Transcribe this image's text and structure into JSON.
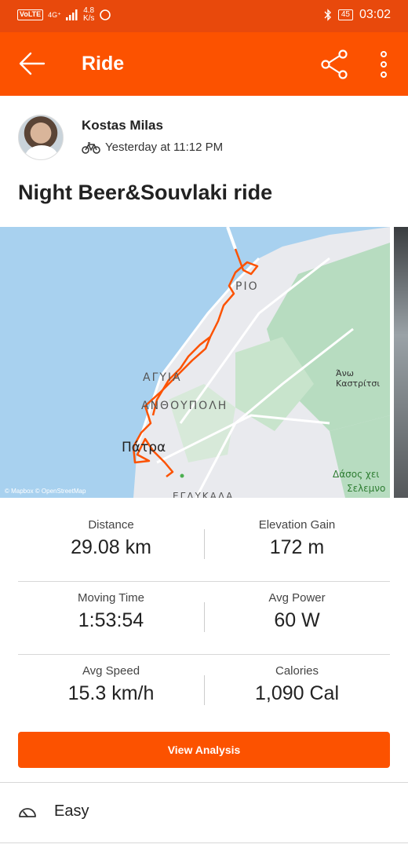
{
  "status_bar": {
    "volte": "VoLTE",
    "network": "4G⁺",
    "speed_value": "4.8",
    "speed_unit": "K/s",
    "battery": "45",
    "time": "03:02"
  },
  "app_bar": {
    "title": "Ride",
    "back_icon": "arrow-left-icon",
    "share_icon": "share-icon",
    "more_icon": "more-vert-icon"
  },
  "athlete": {
    "name": "Kostas Milas",
    "activity_icon": "bicycle-icon",
    "timestamp": "Yesterday at 11:12 PM"
  },
  "activity": {
    "title": "Night Beer&Souvlaki ride"
  },
  "map": {
    "labels": {
      "rio": "ΡΙΟ",
      "agyia": "ΑΓΥΙΑ",
      "anthoupoli": "ΑΝΘΟΥΠΟΛΗ",
      "patra": "Πάτρα",
      "ano_kastritsi": "Άνω Καστρίτσι",
      "dasos": "Δάσος χει",
      "selemno": "Σελεμνο",
      "eglykada": "ΕΓΛΥΚΑΔΑ"
    },
    "credit": "© Mapbox © OpenStreetMap",
    "route_color": "#fc5200",
    "water_color": "#a8d1ef"
  },
  "stats": [
    {
      "label": "Distance",
      "value": "29.08 km"
    },
    {
      "label": "Elevation Gain",
      "value": "172 m"
    },
    {
      "label": "Moving Time",
      "value": "1:53:54"
    },
    {
      "label": "Avg Power",
      "value": "60 W"
    },
    {
      "label": "Avg Speed",
      "value": "15.3 km/h"
    },
    {
      "label": "Calories",
      "value": "1,090 Cal"
    }
  ],
  "view_analysis_label": "View Analysis",
  "effort": {
    "icon": "gauge-icon",
    "label": "Easy"
  },
  "colors": {
    "accent": "#fc5200",
    "status_bar": "#e8490c"
  }
}
